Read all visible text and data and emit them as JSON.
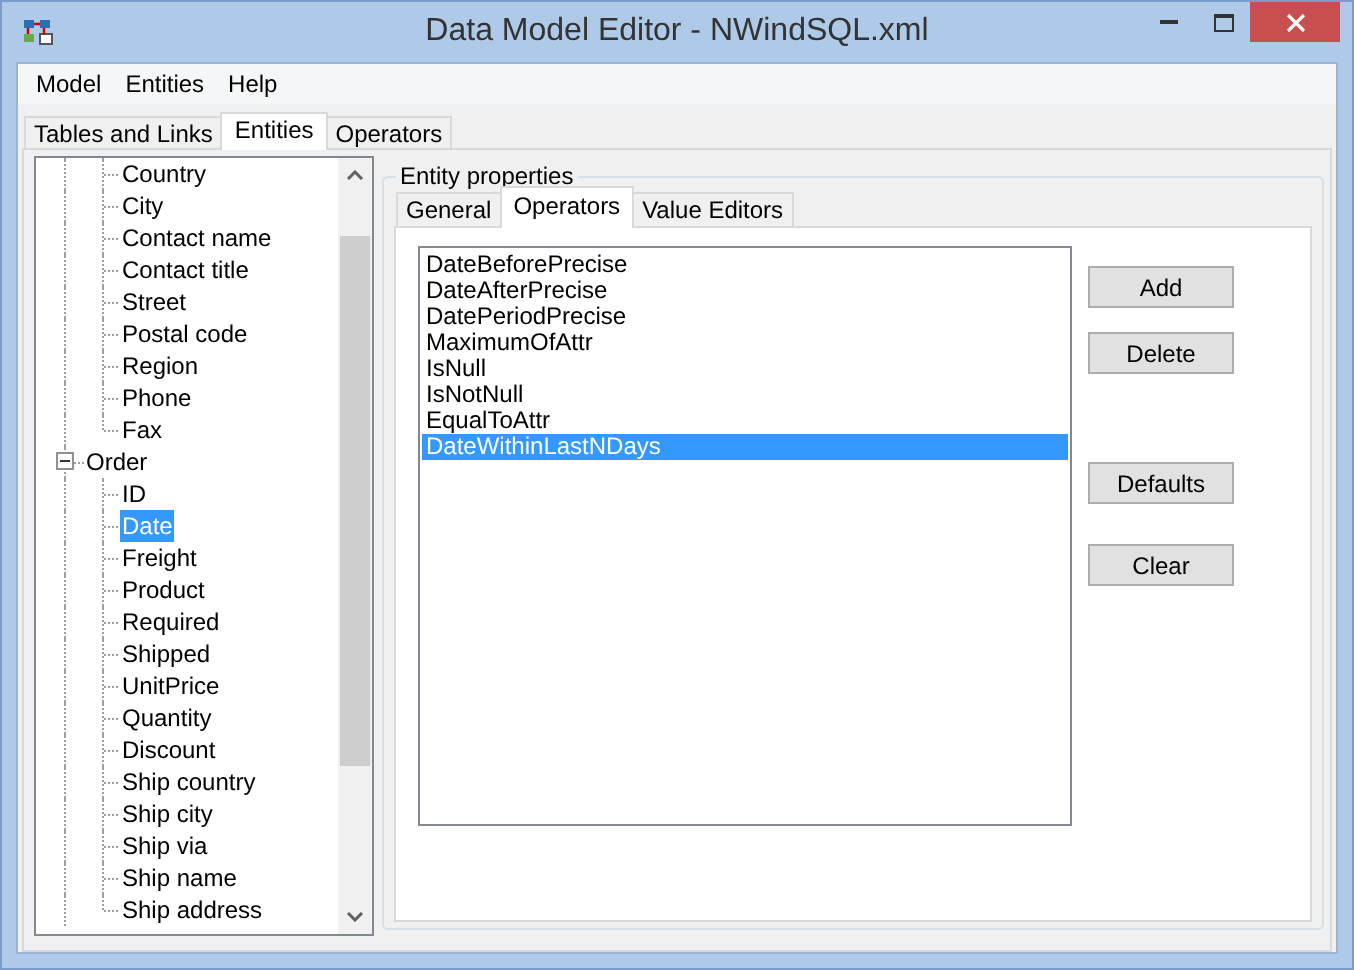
{
  "window": {
    "title": "Data Model Editor - NWindSQL.xml"
  },
  "menu": [
    "Model",
    "Entities",
    "Help"
  ],
  "tabs": [
    {
      "label": "Tables and Links",
      "selected": false
    },
    {
      "label": "Entities",
      "selected": true
    },
    {
      "label": "Operators",
      "selected": false
    }
  ],
  "tree": {
    "items": [
      {
        "kind": "continued",
        "children": [
          {
            "label": "Country",
            "selected": false
          },
          {
            "label": "City",
            "selected": false
          },
          {
            "label": "Contact name",
            "selected": false
          },
          {
            "label": "Contact title",
            "selected": false
          },
          {
            "label": "Street",
            "selected": false
          },
          {
            "label": "Postal code",
            "selected": false
          },
          {
            "label": "Region",
            "selected": false
          },
          {
            "label": "Phone",
            "selected": false
          },
          {
            "label": "Fax",
            "selected": false
          }
        ]
      },
      {
        "kind": "node",
        "label": "Order",
        "selected": false,
        "expanded": true,
        "children": [
          {
            "label": "ID",
            "selected": false
          },
          {
            "label": "Date",
            "selected": true
          },
          {
            "label": "Freight",
            "selected": false
          },
          {
            "label": "Product",
            "selected": false
          },
          {
            "label": "Required",
            "selected": false
          },
          {
            "label": "Shipped",
            "selected": false
          },
          {
            "label": "UnitPrice",
            "selected": false
          },
          {
            "label": "Quantity",
            "selected": false
          },
          {
            "label": "Discount",
            "selected": false
          },
          {
            "label": "Ship country",
            "selected": false
          },
          {
            "label": "Ship city",
            "selected": false
          },
          {
            "label": "Ship via",
            "selected": false
          },
          {
            "label": "Ship name",
            "selected": false
          },
          {
            "label": "Ship address",
            "selected": false
          }
        ]
      }
    ]
  },
  "entity_properties": {
    "title": "Entity properties",
    "tabs": [
      {
        "label": "General",
        "selected": false
      },
      {
        "label": "Operators",
        "selected": true
      },
      {
        "label": "Value Editors",
        "selected": false
      }
    ],
    "operators": [
      {
        "label": "DateBeforePrecise",
        "selected": false
      },
      {
        "label": "DateAfterPrecise",
        "selected": false
      },
      {
        "label": "DatePeriodPrecise",
        "selected": false
      },
      {
        "label": "MaximumOfAttr",
        "selected": false
      },
      {
        "label": "IsNull",
        "selected": false
      },
      {
        "label": "IsNotNull",
        "selected": false
      },
      {
        "label": "EqualToAttr",
        "selected": false
      },
      {
        "label": "DateWithinLastNDays",
        "selected": true
      }
    ],
    "buttons": [
      "Add",
      "Delete",
      "Defaults",
      "Clear"
    ]
  }
}
